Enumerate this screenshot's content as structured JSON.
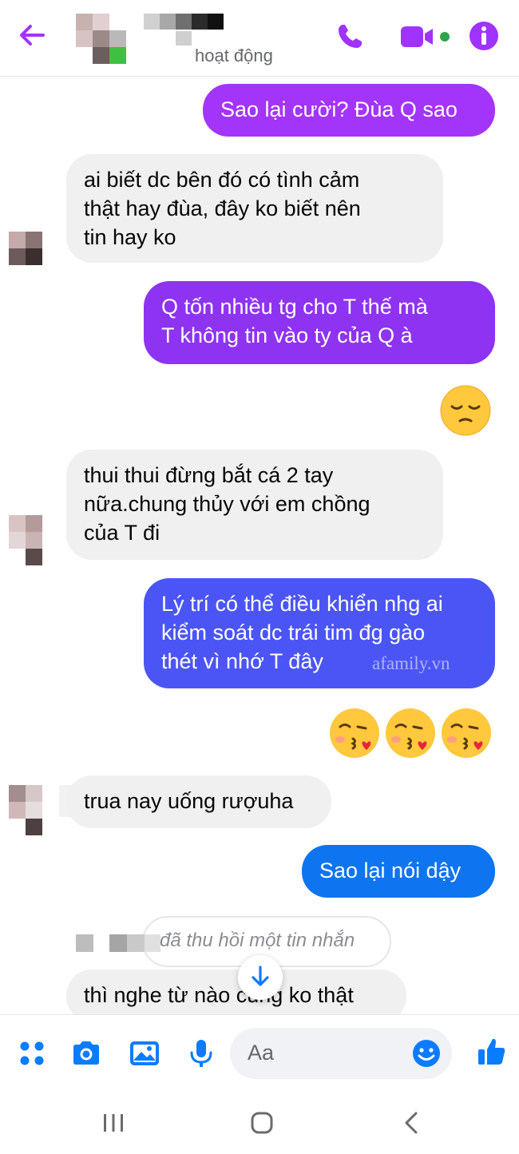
{
  "header": {
    "status": "hoạt động",
    "back_icon": "arrow-left-icon",
    "call_icon": "phone-icon",
    "video_icon": "video-camera-icon",
    "info_icon": "info-icon",
    "accent": "#a033ff",
    "online_dot": "#31a24c"
  },
  "messages": [
    {
      "from": "me",
      "lines": [
        "Sao lại cười? Đùa Q sao"
      ]
    },
    {
      "from": "them",
      "lines": [
        "ai biết dc bên đó có tình cảm",
        "thật hay đùa, đây ko biết nên",
        "tin hay ko"
      ]
    },
    {
      "from": "me",
      "lines": [
        "Q tốn nhiều tg cho T thế mà",
        "T không tin vào ty của Q à"
      ]
    },
    {
      "from": "me",
      "emoji": "pensive-face"
    },
    {
      "from": "them",
      "lines": [
        "thui thui đừng bắt cá 2 tay",
        "nữa.chung thủy với em chồng",
        "của T đi"
      ]
    },
    {
      "from": "me",
      "lines": [
        "Lý trí có thể điều khiển nhg ai",
        "kiểm soát dc trái tim đg gào",
        "thét vì nhớ T đây"
      ]
    },
    {
      "from": "me",
      "emoji": "face-blowing-kiss x3"
    },
    {
      "from": "them",
      "lines": [
        "trua nay uống rượuha"
      ]
    },
    {
      "from": "me",
      "lines": [
        "Sao lại nói dậy"
      ]
    },
    {
      "from": "them",
      "lines": [
        "thì nghe từ nào cũng ko thật"
      ]
    }
  ],
  "recalled_note": "đã thu hồi một tin nhắn",
  "watermark": "afamily.vn",
  "composer": {
    "placeholder": "Aa",
    "icons": [
      "menu-dots-icon",
      "camera-icon",
      "gallery-icon",
      "microphone-icon",
      "emoji-icon",
      "thumbs-up-icon"
    ],
    "icon_color": "#0a7cff"
  },
  "system_nav": [
    "recents-icon",
    "home-icon",
    "back-icon"
  ]
}
